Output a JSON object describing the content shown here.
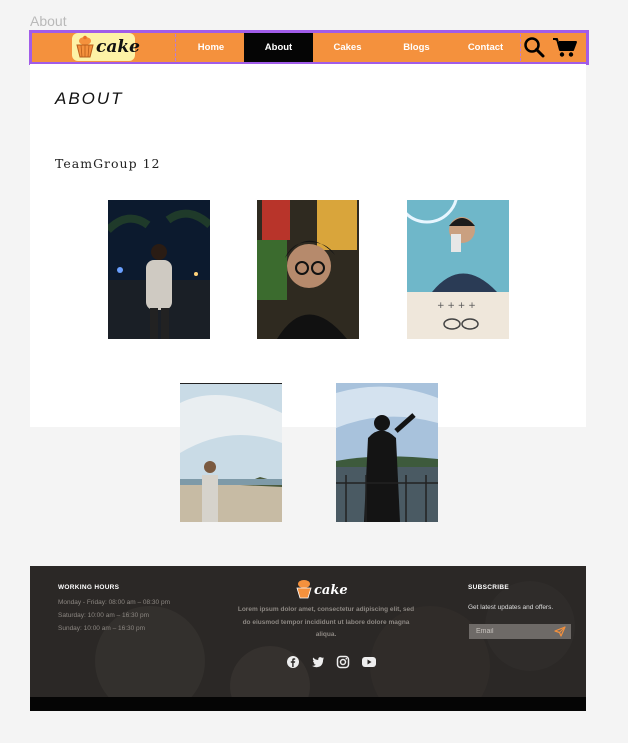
{
  "frame": {
    "label": "About"
  },
  "brand": {
    "name": "cake",
    "color": "#f4913d"
  },
  "nav": {
    "items": [
      {
        "label": "Home",
        "active": false
      },
      {
        "label": "About",
        "active": true
      },
      {
        "label": "Cakes",
        "active": false
      },
      {
        "label": "Blogs",
        "active": false
      },
      {
        "label": "Contact",
        "active": false
      }
    ],
    "search_icon": "search-icon",
    "cart_icon": "cart-icon"
  },
  "page": {
    "title": "ABOUT",
    "team": "TeamGroup 12",
    "photos": [
      "member-1",
      "member-2",
      "member-3",
      "member-4",
      "member-5"
    ]
  },
  "footer": {
    "hours": {
      "title": "WORKING HOURS",
      "lines": [
        "Monday - Friday: 08:00 am – 08:30 pm",
        "Saturday: 10:00 am – 16:30 pm",
        "Sunday: 10:00 am – 16:30 pm"
      ]
    },
    "about_text": "Lorem ipsum dolor amet, consectetur adipiscing elit, sed do eiusmod tempor incididunt ut labore dolore magna aliqua.",
    "subscribe": {
      "title": "SUBSCRIBE",
      "text": "Get latest updates and offers.",
      "email_placeholder": "Email"
    },
    "social_icons": [
      "facebook-icon",
      "twitter-icon",
      "instagram-icon",
      "youtube-icon"
    ]
  }
}
